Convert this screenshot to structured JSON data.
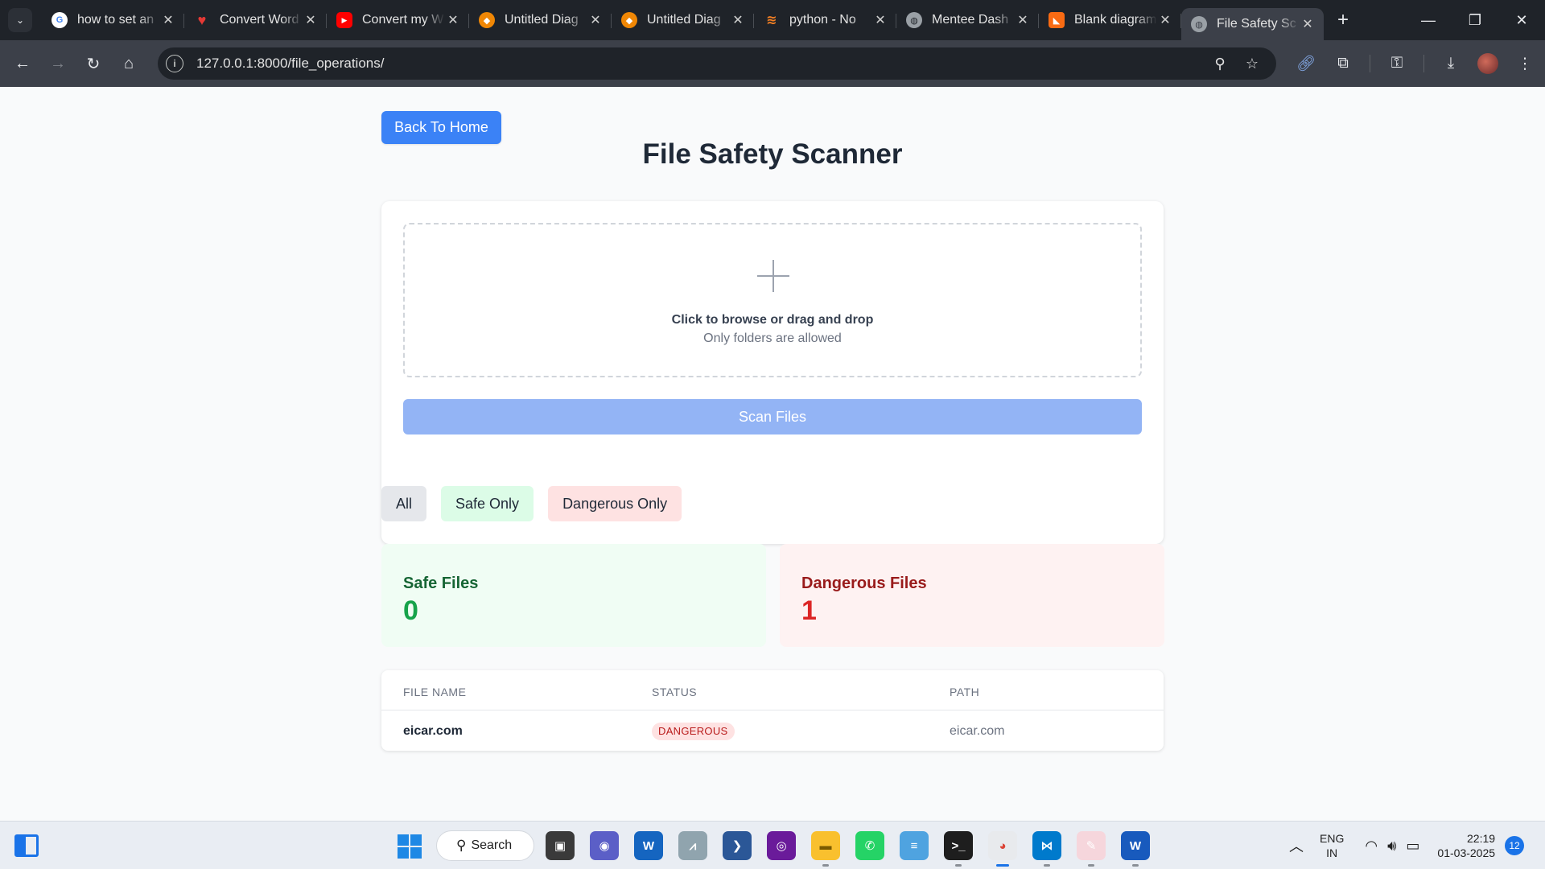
{
  "browser": {
    "tabs": [
      {
        "title": "how to set an",
        "favicon": "google-icon",
        "color": "#ffffff"
      },
      {
        "title": "Convert Word",
        "favicon": "heart-icon",
        "color": "#e53935"
      },
      {
        "title": "Convert my W",
        "favicon": "youtube-icon",
        "color": "#ff0000"
      },
      {
        "title": "Untitled Diag",
        "favicon": "drawio-icon",
        "color": "#f08705"
      },
      {
        "title": "Untitled Diag",
        "favicon": "drawio-icon",
        "color": "#f08705"
      },
      {
        "title": "python - No",
        "favicon": "stackoverflow-icon",
        "color": "#f48024"
      },
      {
        "title": "Mentee Dash",
        "favicon": "globe-icon",
        "color": "#9aa0a6"
      },
      {
        "title": "Blank diagram",
        "favicon": "lucidchart-icon",
        "color": "#f96b13"
      },
      {
        "title": "File Safety Sc",
        "favicon": "globe-icon",
        "color": "#9aa0a6"
      }
    ],
    "url": "127.0.0.1:8000/file_operations/"
  },
  "page": {
    "back_button": "Back To Home",
    "title": "File Safety Scanner",
    "dropzone": {
      "main_text": "Click to browse or drag and drop",
      "sub_text": "Only folders are allowed"
    },
    "scan_button": "Scan Files",
    "filters": [
      "All",
      "Safe Only",
      "Dangerous Only"
    ],
    "stats": {
      "safe": {
        "label": "Safe Files",
        "value": "0"
      },
      "dangerous": {
        "label": "Dangerous Files",
        "value": "1"
      }
    },
    "table": {
      "headers": [
        "FILE NAME",
        "STATUS",
        "PATH"
      ],
      "rows": [
        {
          "name": "eicar.com",
          "status": "DANGEROUS",
          "path": "eicar.com"
        }
      ]
    }
  },
  "taskbar": {
    "search_label": "Search",
    "language": {
      "line1": "ENG",
      "line2": "IN"
    },
    "time": "22:19",
    "date": "01-03-2025",
    "notification_count": "12"
  }
}
